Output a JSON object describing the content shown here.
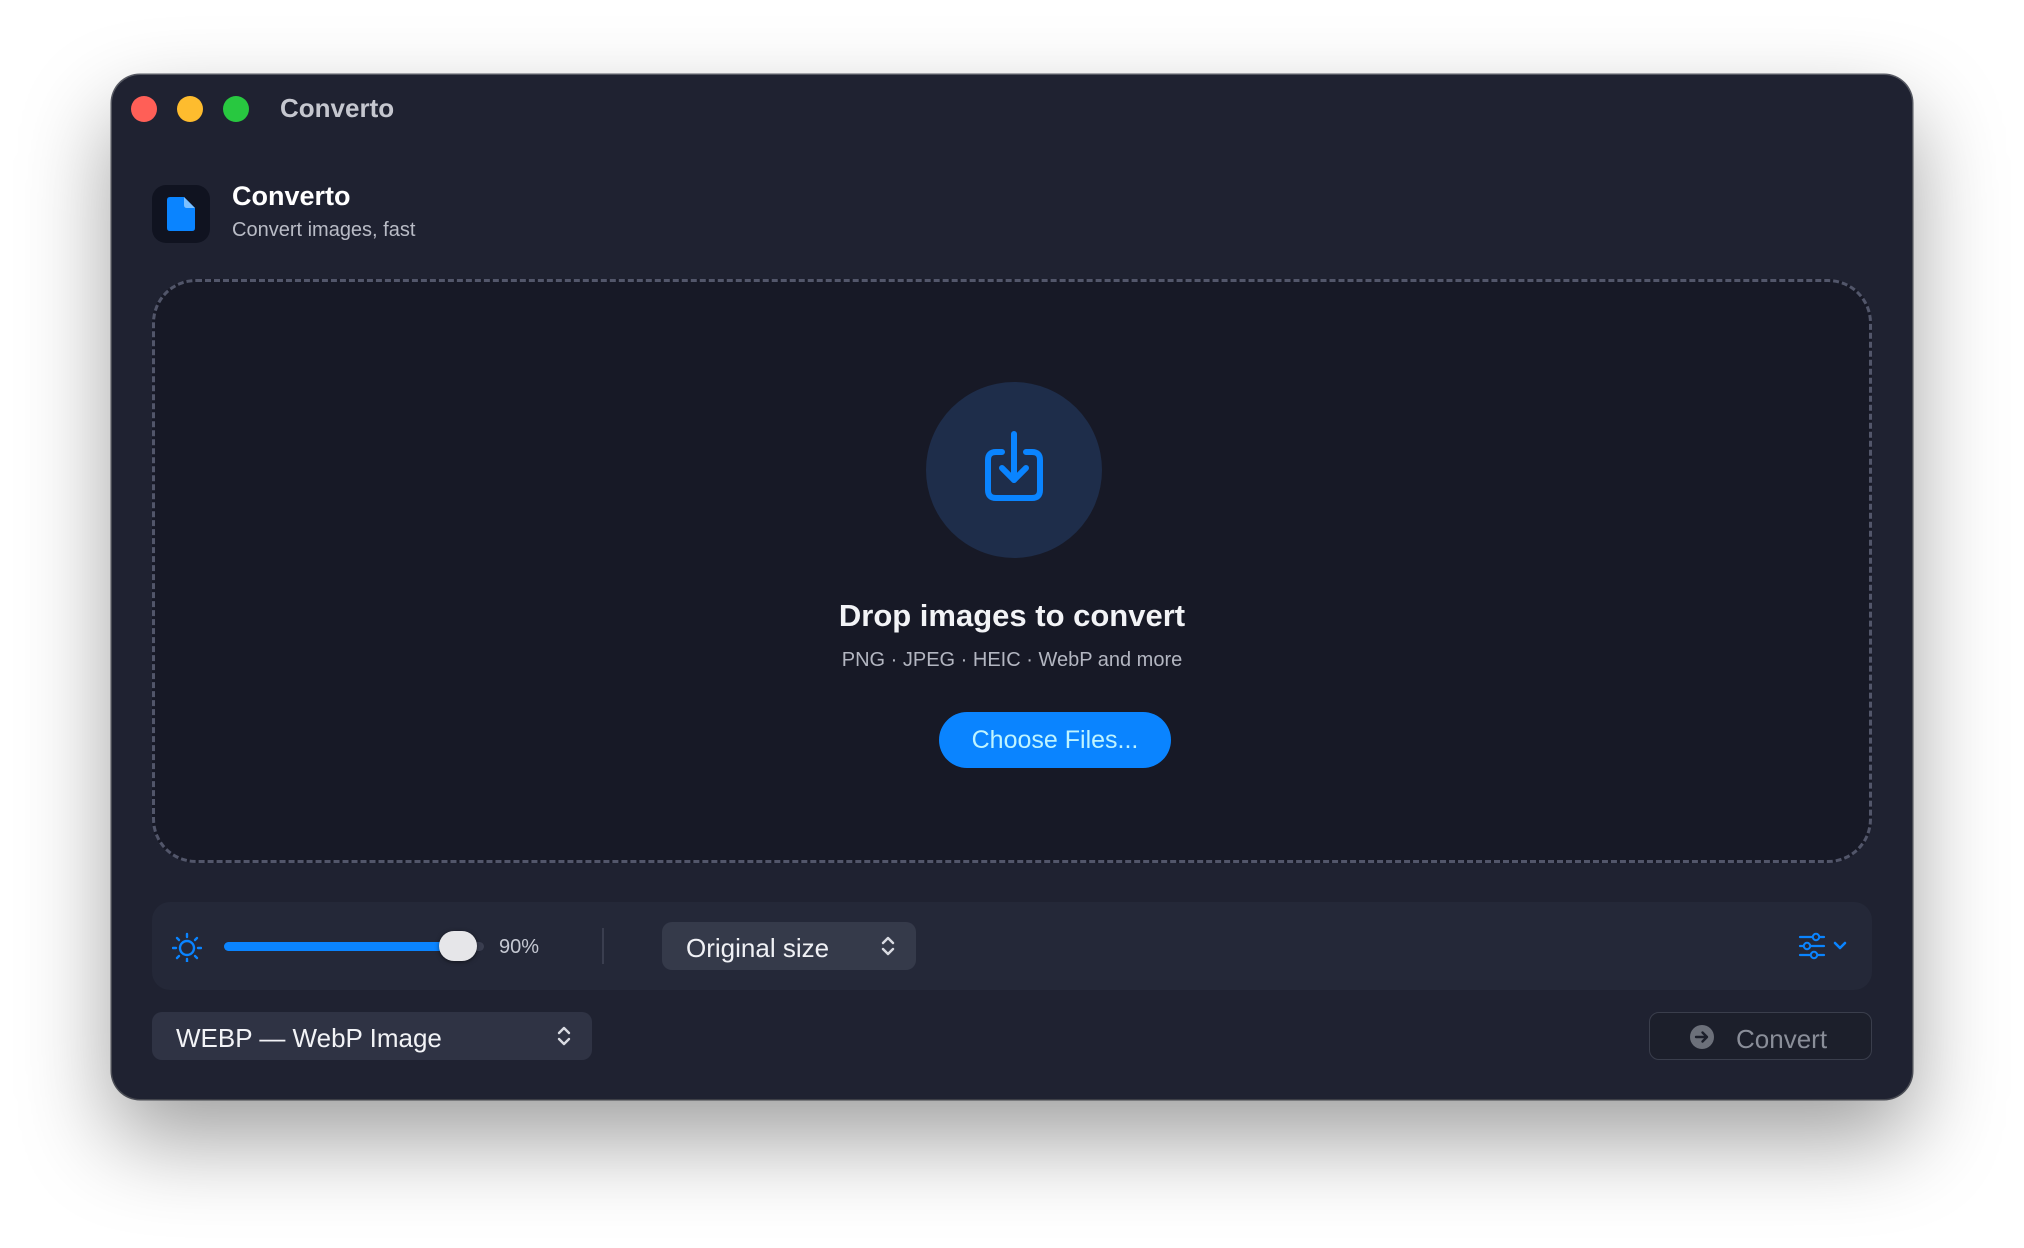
{
  "window": {
    "title": "Converto"
  },
  "header": {
    "app_name": "Converto",
    "tagline": "Convert images, fast"
  },
  "dropzone": {
    "title": "Drop images to convert",
    "formats": "PNG · JPEG · HEIC · WebP and more",
    "choose_label": "Choose Files..."
  },
  "toolbar": {
    "quality_value": "90%",
    "quality_fraction": 0.9,
    "size_option": "Original size"
  },
  "footer": {
    "format_option": "WEBP — WebP Image",
    "convert_label": "Convert"
  },
  "colors": {
    "accent": "#0a84ff",
    "window_bg": "#1f2231",
    "dropzone_bg": "#171926",
    "traffic_red": "#ff5f57",
    "traffic_yellow": "#febc2e",
    "traffic_green": "#28c840"
  },
  "icons": {
    "app": "document-icon",
    "dropzone": "download-tray-icon",
    "quality": "sun-icon",
    "size": "chevron-up-down-icon",
    "settings": "sliders-icon",
    "convert": "arrow-circle-icon"
  }
}
